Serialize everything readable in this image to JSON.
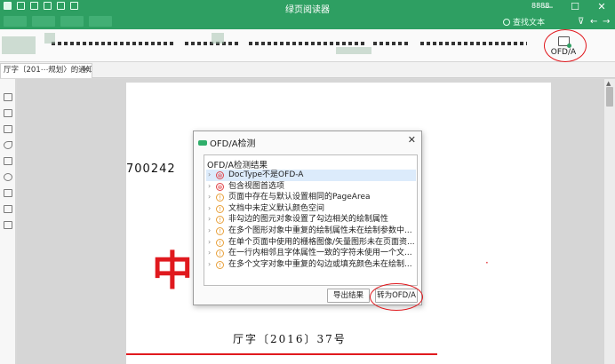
{
  "window": {
    "title": "绿页阅读器",
    "user": "8888",
    "controls": {
      "minimize": "—",
      "maximize": "☐",
      "close": "✕"
    }
  },
  "search": {
    "label": "查找文本"
  },
  "toolbar": {
    "ofd_label": "OFD/A"
  },
  "tab": {
    "label": "厅字〔201⋯规划〉的通知",
    "close": "✕"
  },
  "document": {
    "number": "700242",
    "red_heading": "中",
    "red_mark": "·",
    "doc_no": "厅字〔2016〕37号"
  },
  "dialog": {
    "title": "OFD/A检测",
    "close": "✕",
    "results_label": "OFD/A检测结果",
    "results": [
      {
        "text": "DocType不是OFD-A",
        "status": "error"
      },
      {
        "text": "包含视图首选项",
        "status": "error"
      },
      {
        "text": "页面中存在与默认设置相同的PageArea",
        "status": "warning"
      },
      {
        "text": "文档中未定义默认颜色空间",
        "status": "warning"
      },
      {
        "text": "非勾边的图元对象设置了勾边相关的绘制属性",
        "status": "warning"
      },
      {
        "text": "在多个图形对象中重复的绘制属性未在绘制参数中...",
        "status": "warning"
      },
      {
        "text": "在单个页面中使用的栅格图像/矢量图形未在页面资...",
        "status": "warning"
      },
      {
        "text": "在一行内相邻且字体属性一致的字符未使用一个文...",
        "status": "warning"
      },
      {
        "text": "在多个文字对象中重复的勾边或填充颜色未在绘制...",
        "status": "warning"
      }
    ],
    "export_button": "导出结果",
    "convert_button": "转为OFD/A"
  },
  "colors": {
    "brand": "#2e9f62",
    "annotation": "#e0191e",
    "error": "#e0454b",
    "warning": "#e8a03a"
  },
  "icons": {
    "error": "⊗",
    "warning": "!",
    "chevron": "›"
  }
}
